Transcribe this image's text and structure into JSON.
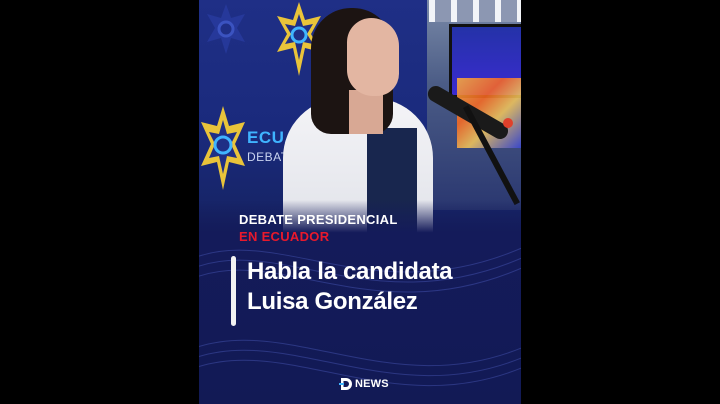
{
  "video": {
    "kicker_line1": "DEBATE PRESIDENCIAL",
    "kicker_line2": "EN ECUADOR",
    "headline_line1": "Habla la candidata",
    "headline_line2": "Luisa González",
    "brand": "NEWS",
    "backdrop_logo_text": "ECUAD",
    "backdrop_logo_subtext": "DEBATE",
    "backdrop_logo_text_small": "E"
  },
  "colors": {
    "background": "#000000",
    "panel": "#141b5a",
    "kicker_accent": "#e8192c",
    "text": "#ffffff",
    "logo_blue": "#3fb4ff",
    "logo_gold": "#e9c43a"
  },
  "icons": {
    "brand_mark": "d-logo-icon",
    "backdrop_badge": "star-emblem-icon"
  }
}
